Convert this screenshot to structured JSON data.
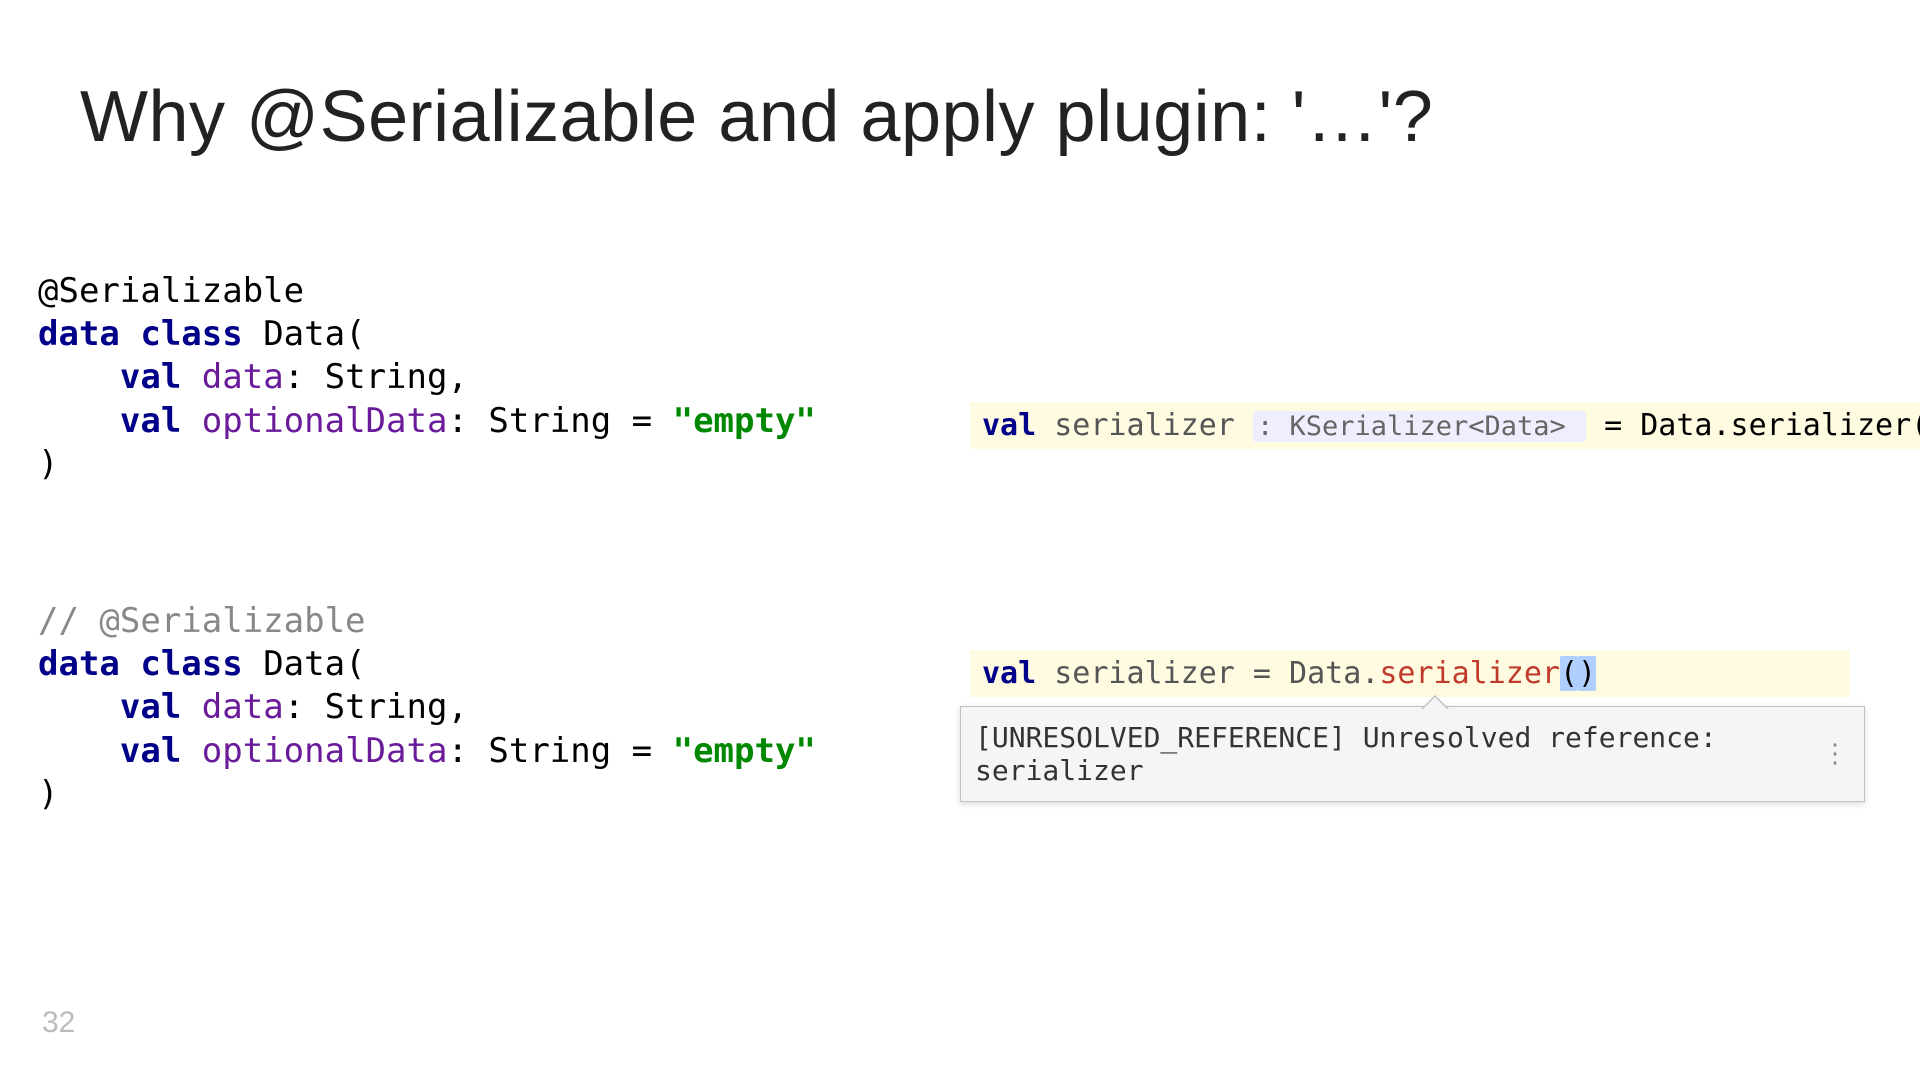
{
  "title": "Why @Serializable and apply plugin: '…'?",
  "page_number": "32",
  "code1": {
    "annotation": "@Serializable",
    "decl": "data class",
    "class_name": "Data(",
    "val": "val",
    "field1": "data",
    "field1_rest": ": String,",
    "field2": "optionalData",
    "field2_rest": ": String = ",
    "str_literal": "\"empty\"",
    "close": ")"
  },
  "code2": {
    "comment": "// @Serializable",
    "decl": "data class",
    "class_name": "Data(",
    "val": "val",
    "field1": "data",
    "field1_rest": ": String,",
    "field2": "optionalData",
    "field2_rest": ": String = ",
    "str_literal": "\"empty\"",
    "close": ")"
  },
  "ide1": {
    "val": "val",
    "var": " serializer ",
    "hint": ": KSerializer<Data> ",
    "eq": " = Data.serializer()"
  },
  "ide2": {
    "val": "val",
    "var": " serializer = Data.",
    "call": "serializer",
    "p1": "(",
    "p2": ")"
  },
  "tooltip": {
    "text": "[UNRESOLVED_REFERENCE] Unresolved reference: serializer",
    "more": "⋮"
  }
}
